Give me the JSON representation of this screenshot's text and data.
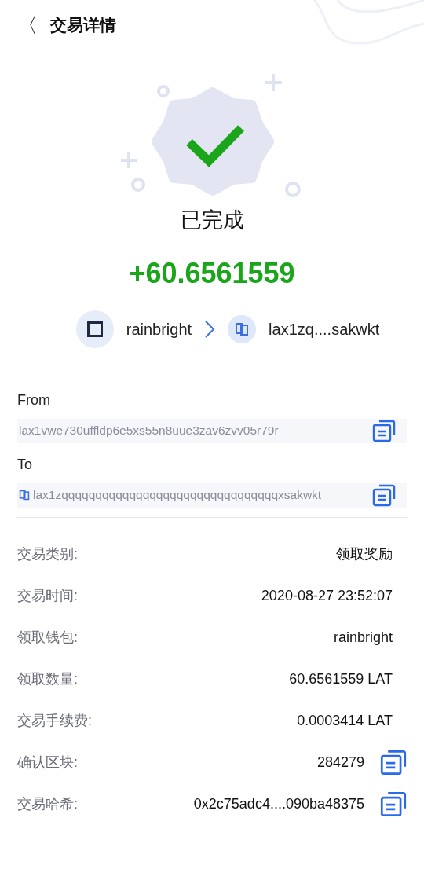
{
  "header": {
    "back": "〈",
    "title": "交易详情"
  },
  "status": {
    "label": "已完成",
    "amount": "+60.6561559"
  },
  "parties": {
    "sender": "rainbright",
    "receiver": "lax1zq....sakwkt"
  },
  "addresses": [
    {
      "label": "From",
      "value": "lax1vwe730uffldp6e5xs55n8uue3zav6zvv05r79r",
      "prefix_icon": false
    },
    {
      "label": "To",
      "value": "lax1zqqqqqqqqqqqqqqqqqqqqqqqqqqqqqqqqxsakwkt",
      "prefix_icon": true
    }
  ],
  "details": [
    {
      "label": "交易类别:",
      "value": "领取奖励",
      "kind": "plain"
    },
    {
      "label": "交易时间:",
      "value": "2020-08-27 23:52:07",
      "kind": "plain"
    },
    {
      "label": "领取钱包:",
      "value": "rainbright",
      "kind": "plain"
    },
    {
      "label": "领取数量:",
      "value": "60.6561559 LAT",
      "kind": "plain"
    },
    {
      "label": "交易手续费:",
      "value": "0.0003414 LAT",
      "kind": "plain"
    },
    {
      "label": "确认区块:",
      "value": "284279",
      "kind": "copyable"
    },
    {
      "label": "交易哈希:",
      "value": "0x2c75adc4....090ba48375",
      "kind": "copyable"
    }
  ]
}
